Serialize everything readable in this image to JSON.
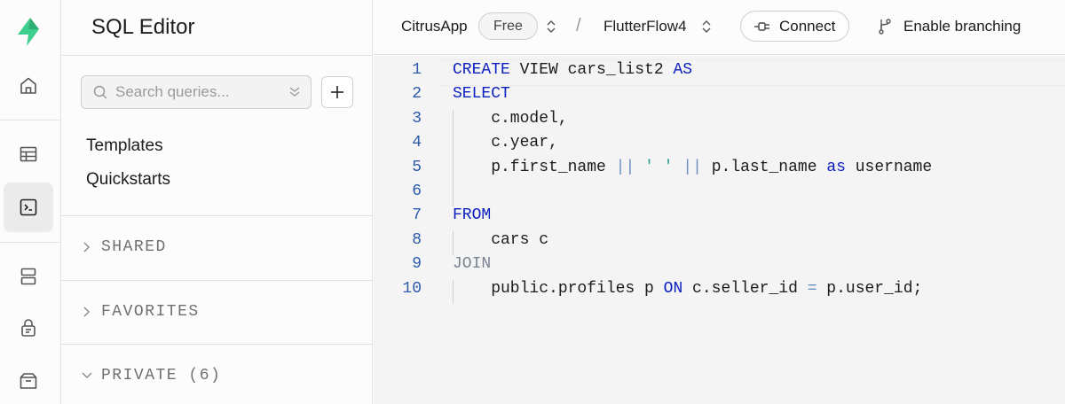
{
  "sidebar": {
    "title": "SQL Editor",
    "search_placeholder": "Search queries...",
    "links": [
      "Templates",
      "Quickstarts"
    ],
    "sections": [
      "SHARED",
      "FAVORITES",
      "PRIVATE (6)"
    ]
  },
  "topbar": {
    "org": "CitrusApp",
    "plan_badge": "Free",
    "project": "FlutterFlow4",
    "connect_label": "Connect",
    "branching_label": "Enable branching"
  },
  "editor": {
    "lines": [
      {
        "no": "1",
        "tokens": [
          {
            "t": "CREATE",
            "c": "kw"
          },
          {
            "t": " VIEW cars_list2 ",
            "c": ""
          },
          {
            "t": "AS",
            "c": "kw"
          }
        ]
      },
      {
        "no": "2",
        "tokens": [
          {
            "t": "SELECT",
            "c": "kw"
          }
        ]
      },
      {
        "no": "3",
        "tokens": [
          {
            "t": "    c.model,",
            "c": ""
          }
        ]
      },
      {
        "no": "4",
        "tokens": [
          {
            "t": "    c.year,",
            "c": ""
          }
        ]
      },
      {
        "no": "5",
        "tokens": [
          {
            "t": "    p.first_name ",
            "c": ""
          },
          {
            "t": "||",
            "c": "op"
          },
          {
            "t": " ",
            "c": ""
          },
          {
            "t": "' '",
            "c": "str"
          },
          {
            "t": " ",
            "c": ""
          },
          {
            "t": "||",
            "c": "op"
          },
          {
            "t": " p.last_name ",
            "c": ""
          },
          {
            "t": "as",
            "c": "kw"
          },
          {
            "t": " username",
            "c": ""
          }
        ]
      },
      {
        "no": "6",
        "tokens": []
      },
      {
        "no": "7",
        "tokens": [
          {
            "t": "FROM",
            "c": "kw"
          }
        ]
      },
      {
        "no": "8",
        "tokens": [
          {
            "t": "    cars c",
            "c": ""
          }
        ]
      },
      {
        "no": "9",
        "tokens": [
          {
            "t": "JOIN",
            "c": "kw2"
          }
        ]
      },
      {
        "no": "10",
        "tokens": [
          {
            "t": "    public.profiles p ",
            "c": ""
          },
          {
            "t": "ON",
            "c": "kw"
          },
          {
            "t": " c.seller_id ",
            "c": ""
          },
          {
            "t": "=",
            "c": "op"
          },
          {
            "t": " p.user_id;",
            "c": ""
          }
        ]
      }
    ]
  },
  "icons": {
    "logo": "supabase-logo-icon",
    "rail": [
      "home-icon",
      "table-editor-icon",
      "sql-editor-icon",
      "database-icon",
      "auth-lock-icon",
      "storage-icon"
    ]
  },
  "colors": {
    "brand": "#3ecf8e",
    "keyword": "#0b1fbf",
    "line_number": "#2b5aa8",
    "string": "#2d9b8c"
  }
}
